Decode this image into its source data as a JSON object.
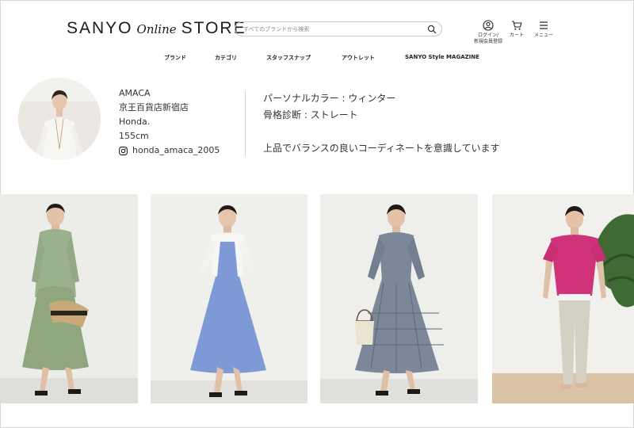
{
  "header": {
    "logo": {
      "part1": "SANYO",
      "part2": "Online",
      "part3": "STORE"
    },
    "search": {
      "placeholder": "すべてのブランドから検索",
      "value": "",
      "icon": "search-icon"
    },
    "icons": [
      {
        "label": "ログイン/",
        "label2": "新規会員登録",
        "icon": "user-icon"
      },
      {
        "label": "カート",
        "icon": "cart-icon"
      },
      {
        "label": "メニュー",
        "icon": "hamburger-icon"
      }
    ]
  },
  "nav": [
    "ブランド",
    "カテゴリ",
    "スタッフスナップ",
    "アウトレット",
    "SANYO Style MAGAZINE"
  ],
  "profile": {
    "brand": "AMACA",
    "store": "京王百貨店新宿店",
    "name": "Honda.",
    "height": "155cm",
    "instagram": "honda_amaca_2005",
    "personal_color": "パーソナルカラー : ウィンター",
    "body_type": "骨格診断 : ストレート",
    "comment": "上品でバランスの良いコーディネートを意識しています"
  },
  "colors": {
    "text": "#333333",
    "border": "#cfcfcf",
    "photo1_dress": "#9bb08c",
    "photo2_dress": "#7e9ad6",
    "photo3_dress": "#7c8799",
    "photo4_top": "#d0337a"
  }
}
